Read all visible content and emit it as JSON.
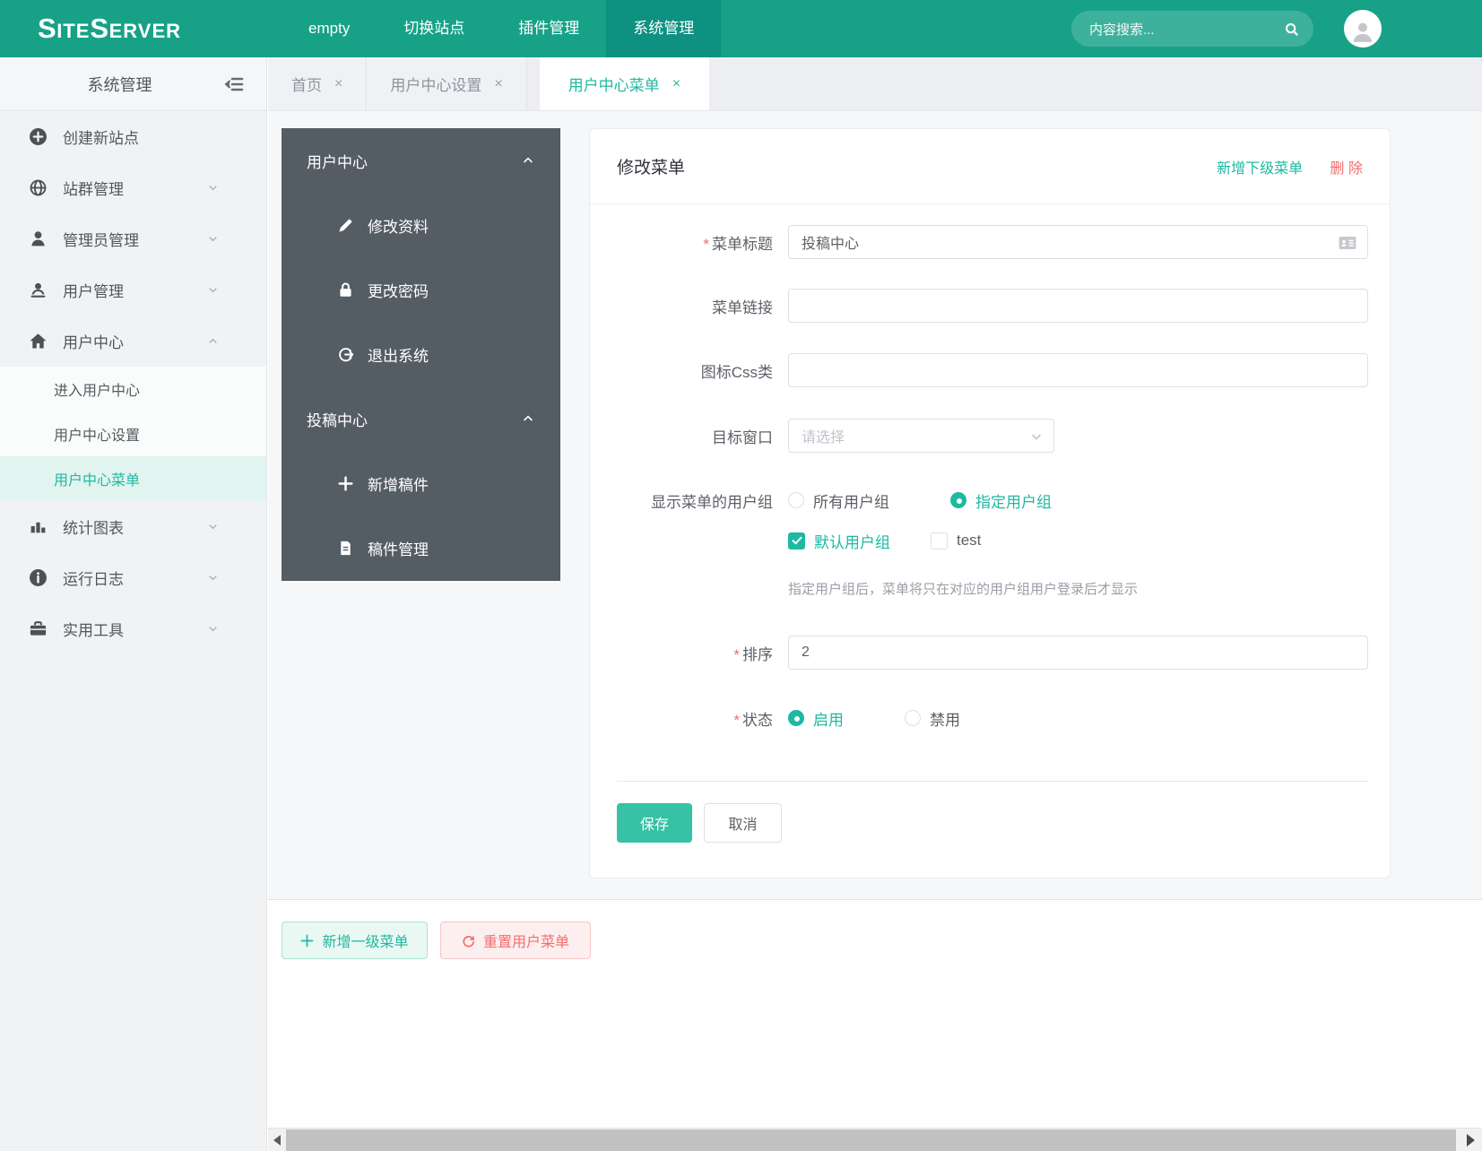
{
  "colors": {
    "accent": "#1eb9a1",
    "header_bg": "#17a288",
    "nav_active_bg": "#0f9181",
    "panel_bg": "#545c64",
    "danger": "#f56c6c",
    "save_btn": "#35c2a5"
  },
  "header": {
    "logo_parts": [
      "S",
      "ITE",
      "S",
      "ERVER"
    ],
    "nav": [
      {
        "label": "empty"
      },
      {
        "label": "切换站点"
      },
      {
        "label": "插件管理"
      },
      {
        "label": "系统管理",
        "active": true
      }
    ],
    "search_placeholder": "内容搜索..."
  },
  "sidebar": {
    "title": "系统管理",
    "items": [
      {
        "label": "创建新站点",
        "icon": "plus-circle-icon",
        "has_children": false
      },
      {
        "label": "站群管理",
        "icon": "globe-icon",
        "has_children": true
      },
      {
        "label": "管理员管理",
        "icon": "admin-user-icon",
        "has_children": true
      },
      {
        "label": "用户管理",
        "icon": "users-icon",
        "has_children": true
      },
      {
        "label": "用户中心",
        "icon": "home-icon",
        "has_children": true,
        "expanded": true
      }
    ],
    "user_center_children": [
      {
        "label": "进入用户中心",
        "active": false
      },
      {
        "label": "用户中心设置",
        "active": false
      },
      {
        "label": "用户中心菜单",
        "active": true
      }
    ],
    "bottom_items": [
      {
        "label": "统计图表",
        "icon": "chart-bar-icon"
      },
      {
        "label": "运行日志",
        "icon": "info-circle-icon"
      },
      {
        "label": "实用工具",
        "icon": "toolbox-icon"
      }
    ]
  },
  "tabs": [
    {
      "label": "首页",
      "active": false
    },
    {
      "label": "用户中心设置",
      "active": false
    },
    {
      "label": "用户中心菜单",
      "active": true
    }
  ],
  "ui": {
    "close_glyph": "×"
  },
  "menu_panel": {
    "groups": [
      {
        "title": "用户中心",
        "items": [
          {
            "label": "修改资料",
            "icon": "pencil-icon"
          },
          {
            "label": "更改密码",
            "icon": "lock-icon"
          },
          {
            "label": "退出系统",
            "icon": "logout-icon"
          }
        ]
      },
      {
        "title": "投稿中心",
        "items": [
          {
            "label": "新增稿件",
            "icon": "plus-icon"
          },
          {
            "label": "稿件管理",
            "icon": "document-icon"
          }
        ]
      }
    ]
  },
  "form": {
    "title": "修改菜单",
    "required_mark": "*",
    "action_add_child": "新增下级菜单",
    "action_delete": "删 除",
    "fields": {
      "menu_title": {
        "label": "菜单标题",
        "required": true,
        "value": "投稿中心"
      },
      "menu_link": {
        "label": "菜单链接",
        "value": ""
      },
      "icon_css": {
        "label": "图标Css类",
        "value": ""
      },
      "target_window": {
        "label": "目标窗口",
        "placeholder": "请选择"
      },
      "user_groups": {
        "label": "显示菜单的用户组",
        "radios": [
          {
            "label": "所有用户组",
            "checked": false
          },
          {
            "label": "指定用户组",
            "checked": true
          }
        ],
        "checkboxes": [
          {
            "label": "默认用户组",
            "checked": true
          },
          {
            "label": "test",
            "checked": false
          }
        ],
        "help": "指定用户组后，菜单将只在对应的用户组用户登录后才显示"
      },
      "sort": {
        "label": "排序",
        "required": true,
        "value": "2"
      },
      "status": {
        "label": "状态",
        "required": true,
        "radios": [
          {
            "label": "启用",
            "checked": true
          },
          {
            "label": "禁用",
            "checked": false
          }
        ]
      }
    },
    "save_label": "保存",
    "cancel_label": "取消"
  },
  "bottom_toolbar": {
    "add_top_menu": "新增一级菜单",
    "reset_user_menu": "重置用户菜单"
  }
}
